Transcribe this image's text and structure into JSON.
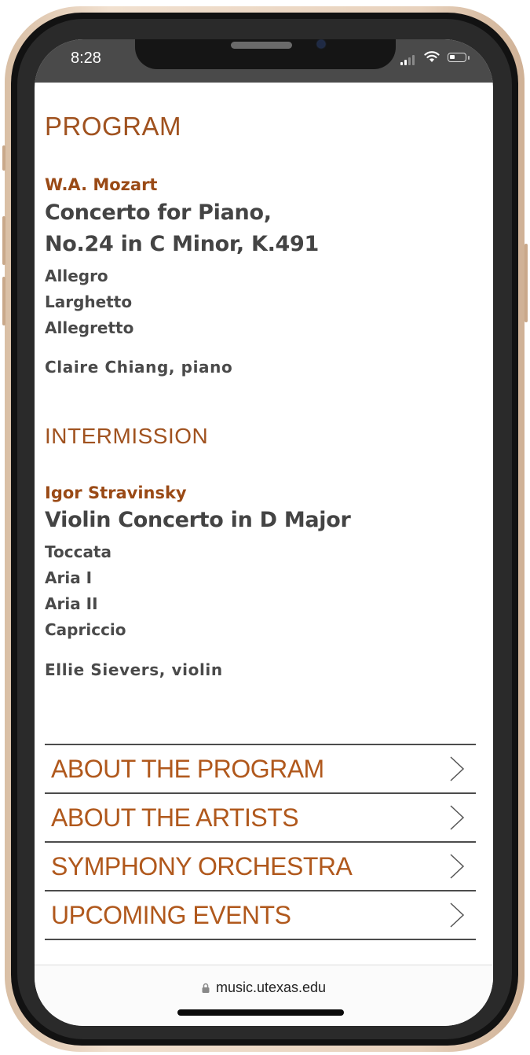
{
  "status_bar": {
    "time": "8:28",
    "signal_icon": "cellular-signal-icon",
    "wifi_icon": "wifi-icon",
    "battery_icon": "battery-icon",
    "battery_level": 0.35
  },
  "program": {
    "heading": "PROGRAM",
    "pieces": [
      {
        "composer": "W.A. Mozart",
        "title_lines": [
          "Concerto for Piano,",
          "No.24 in C Minor, K.491"
        ],
        "movements": [
          "Allegro",
          "Larghetto",
          "Allegretto"
        ],
        "performer": "Claire Chiang, piano"
      }
    ],
    "intermission": "INTERMISSION",
    "pieces_after": [
      {
        "composer": "Igor Stravinsky",
        "title_lines": [
          "Violin Concerto in D Major"
        ],
        "movements": [
          "Toccata",
          "Aria I",
          "Aria II",
          "Capriccio"
        ],
        "performer": "Ellie Sievers, violin"
      }
    ]
  },
  "nav": {
    "items": [
      {
        "label": "ABOUT THE PROGRAM",
        "icon": "chevron-right-icon"
      },
      {
        "label": "ABOUT THE ARTISTS",
        "icon": "chevron-right-icon"
      },
      {
        "label": "SYMPHONY ORCHESTRA",
        "icon": "chevron-right-icon"
      },
      {
        "label": "UPCOMING EVENTS",
        "icon": "chevron-right-icon"
      }
    ]
  },
  "browser": {
    "url": "music.utexas.edu",
    "lock_icon": "lock-icon"
  },
  "colors": {
    "accent": "#a0521f",
    "body_text": "#444444",
    "status_bar": "#4a4a4a"
  }
}
